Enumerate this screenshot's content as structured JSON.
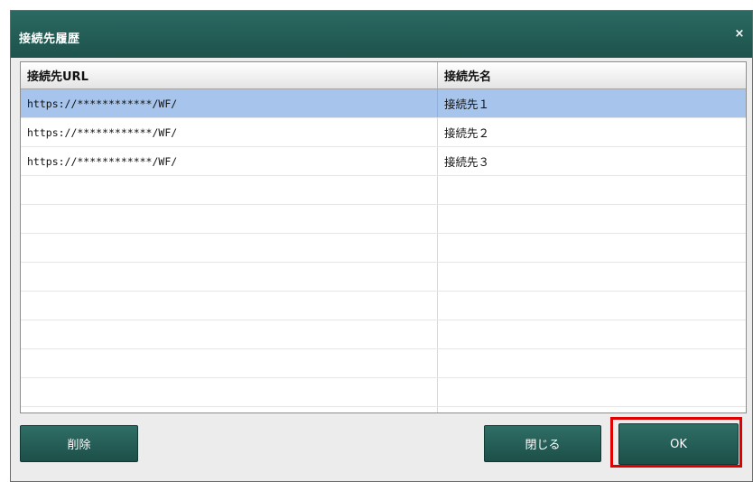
{
  "dialog": {
    "title": "接続先履歴",
    "close_glyph": "×"
  },
  "table": {
    "columns": [
      "接続先URL",
      "接続先名"
    ],
    "rows": [
      {
        "url": "https://************/WF/",
        "name": "接続先１",
        "selected": true
      },
      {
        "url": "https://************/WF/",
        "name": "接続先２",
        "selected": false
      },
      {
        "url": "https://************/WF/",
        "name": "接続先３",
        "selected": false
      }
    ],
    "empty_rows": 9
  },
  "buttons": {
    "delete": "削除",
    "close": "閉じる",
    "ok": "OK"
  },
  "colors": {
    "header_bg": "#1d524b",
    "button_bg": "#245e57",
    "selected_row": "#a6c4ec",
    "highlight_border": "#e00000"
  }
}
